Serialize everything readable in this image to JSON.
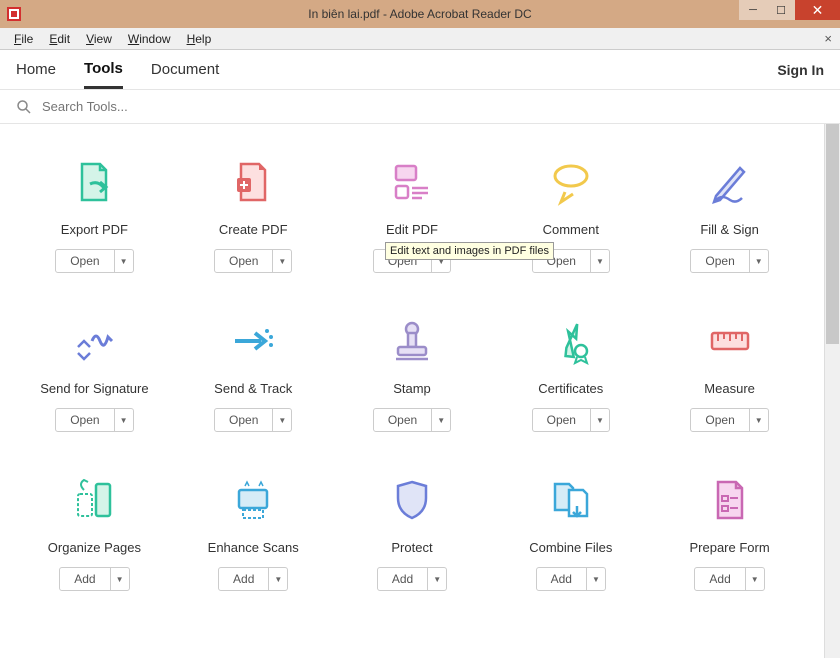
{
  "window": {
    "title": "In biên lai.pdf - Adobe Acrobat Reader DC"
  },
  "menubar": {
    "items": [
      "File",
      "Edit",
      "View",
      "Window",
      "Help"
    ]
  },
  "navbar": {
    "home": "Home",
    "tools": "Tools",
    "document": "Document",
    "signin": "Sign In"
  },
  "search": {
    "placeholder": "Search Tools..."
  },
  "tooltip": {
    "edit_pdf": "Edit text and images in PDF files"
  },
  "buttons": {
    "open": "Open",
    "add": "Add"
  },
  "tools": [
    {
      "label": "Export PDF",
      "action": "open",
      "icon": "export-pdf"
    },
    {
      "label": "Create PDF",
      "action": "open",
      "icon": "create-pdf"
    },
    {
      "label": "Edit PDF",
      "action": "open",
      "icon": "edit-pdf"
    },
    {
      "label": "Comment",
      "action": "open",
      "icon": "comment"
    },
    {
      "label": "Fill & Sign",
      "action": "open",
      "icon": "fill-sign"
    },
    {
      "label": "Send for Signature",
      "action": "open",
      "icon": "send-signature"
    },
    {
      "label": "Send & Track",
      "action": "open",
      "icon": "send-track"
    },
    {
      "label": "Stamp",
      "action": "open",
      "icon": "stamp"
    },
    {
      "label": "Certificates",
      "action": "open",
      "icon": "certificates"
    },
    {
      "label": "Measure",
      "action": "open",
      "icon": "measure"
    },
    {
      "label": "Organize Pages",
      "action": "add",
      "icon": "organize-pages"
    },
    {
      "label": "Enhance Scans",
      "action": "add",
      "icon": "enhance-scans"
    },
    {
      "label": "Protect",
      "action": "add",
      "icon": "protect"
    },
    {
      "label": "Combine Files",
      "action": "add",
      "icon": "combine-files"
    },
    {
      "label": "Prepare Form",
      "action": "add",
      "icon": "prepare-form"
    }
  ]
}
